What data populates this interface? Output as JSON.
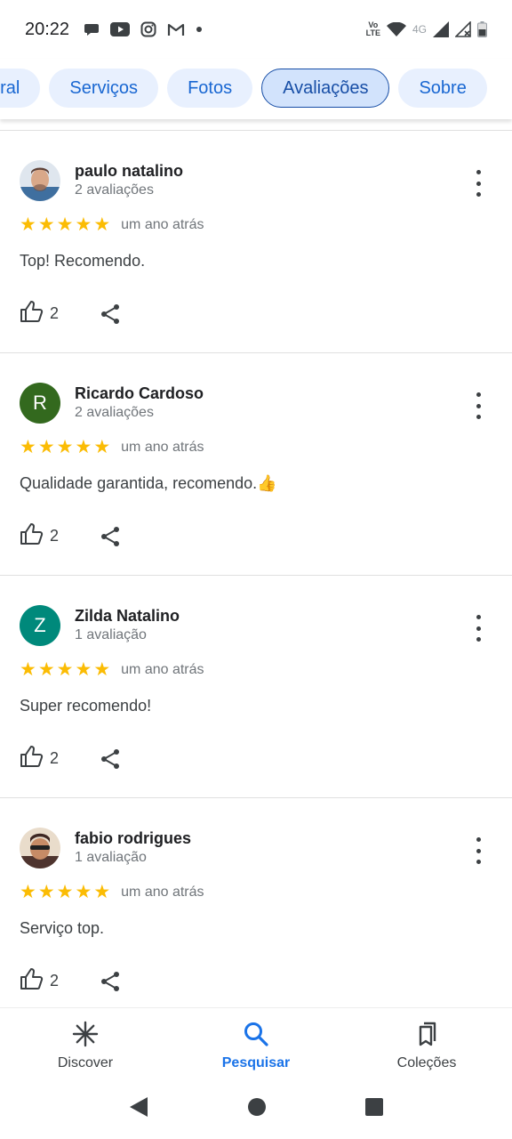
{
  "status_bar": {
    "time": "20:22",
    "left_icons": [
      "chat-bubble-icon",
      "youtube-icon",
      "instagram-icon",
      "gmail-icon",
      "dot-icon"
    ],
    "volte_line1": "Vo",
    "volte_line2": "LTE",
    "network_label": "4G",
    "right_icons": [
      "wifi-icon",
      "signal-icon",
      "signal-no-service-icon",
      "battery-icon"
    ]
  },
  "chips": [
    {
      "label": "eral"
    },
    {
      "label": "Serviços"
    },
    {
      "label": "Fotos"
    },
    {
      "label": "Avaliações",
      "active": true
    },
    {
      "label": "Sobre"
    }
  ],
  "reviews": [
    {
      "name": "paulo natalino",
      "count": "2 avaliações",
      "stars": 5,
      "date": "um ano atrás",
      "text": "Top! Recomendo.",
      "likes": "2",
      "avatar_type": "photo",
      "avatar_letter": ""
    },
    {
      "name": "Ricardo Cardoso",
      "count": "2 avaliações",
      "stars": 5,
      "date": "um ano atrás",
      "text": "Qualidade garantida, recomendo.👍",
      "likes": "2",
      "avatar_type": "letter",
      "avatar_letter": "R",
      "avatar_color": "#33691e"
    },
    {
      "name": "Zilda Natalino",
      "count": "1 avaliação",
      "stars": 5,
      "date": "um ano atrás",
      "text": "Super recomendo!",
      "likes": "2",
      "avatar_type": "letter",
      "avatar_letter": "Z",
      "avatar_color": "#00897b"
    },
    {
      "name": "fabio rodrigues",
      "count": "1 avaliação",
      "stars": 5,
      "date": "um ano atrás",
      "text": "Serviço top.",
      "likes": "2",
      "avatar_type": "photo",
      "avatar_letter": ""
    }
  ],
  "bottom_nav": {
    "discover": "Discover",
    "search": "Pesquisar",
    "collections": "Coleções",
    "active": "search"
  },
  "colors": {
    "accent": "#1a73e8",
    "chip_bg": "#e8f0fe",
    "star": "#fbbc04"
  }
}
